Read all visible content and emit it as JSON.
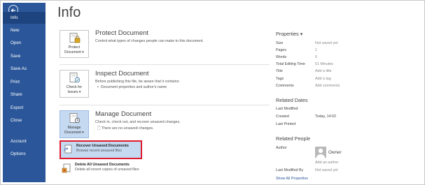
{
  "sidebar": {
    "items": [
      {
        "label": "Info",
        "active": true
      },
      {
        "label": "New"
      },
      {
        "label": "Open"
      },
      {
        "label": "Save"
      },
      {
        "label": "Save As"
      },
      {
        "label": "Print"
      },
      {
        "label": "Share"
      },
      {
        "label": "Export"
      },
      {
        "label": "Close"
      },
      {
        "label": "Account"
      },
      {
        "label": "Options"
      }
    ]
  },
  "main": {
    "title": "Info",
    "protect": {
      "button_line1": "Protect",
      "button_line2": "Document ▾",
      "title": "Protect Document",
      "desc": "Control what types of changes people can make to this document."
    },
    "inspect": {
      "button_line1": "Check for",
      "button_line2": "Issues ▾",
      "title": "Inspect Document",
      "desc": "Before publishing this file, be aware that it contains:",
      "bullet": "Document properties and author's name"
    },
    "manage": {
      "button_line1": "Manage",
      "button_line2": "Document ▾",
      "title": "Manage Document",
      "desc": "Check in, check out, and recover unsaved changes.",
      "status": "There are no unsaved changes."
    },
    "recover": {
      "title": "Recover Unsaved Documents",
      "desc": "Browse recent unsaved files"
    },
    "delete": {
      "title": "Delete All Unsaved Documents",
      "desc": "Delete all recent copies of unsaved files"
    }
  },
  "properties": {
    "header": "Properties ▾",
    "rows": [
      {
        "key": "Size",
        "value": "Not saved yet"
      },
      {
        "key": "Pages",
        "value": "1"
      },
      {
        "key": "Words",
        "value": "0"
      },
      {
        "key": "Total Editing Time",
        "value": "51 Minutes"
      },
      {
        "key": "Title",
        "value": "Add a title"
      },
      {
        "key": "Tags",
        "value": "Add a tag"
      },
      {
        "key": "Comments",
        "value": "Add comments"
      }
    ]
  },
  "related_dates": {
    "header": "Related Dates",
    "rows": [
      {
        "key": "Last Modified",
        "value": ""
      },
      {
        "key": "Created",
        "value": "Today, 14:02"
      },
      {
        "key": "Last Printed",
        "value": ""
      }
    ]
  },
  "related_people": {
    "header": "Related People",
    "author_label": "Author",
    "author_name": "Owner",
    "add_author": "Add an author",
    "last_modified_by_label": "Last Modified By",
    "last_modified_by_value": "Not saved yet",
    "show_all": "Show All Properties"
  },
  "colors": {
    "sidebar": "#2b579a",
    "sidebar_active": "#1e4480",
    "highlight": "#c5d9f1",
    "annotation_red": "#e01b2f"
  },
  "icons": {
    "back": "back-arrow-icon",
    "protect": "lock-document-icon",
    "inspect": "check-document-icon",
    "manage": "manage-document-icon",
    "recover": "recover-document-icon",
    "delete": "delete-document-icon",
    "avatar": "person-avatar-icon"
  }
}
